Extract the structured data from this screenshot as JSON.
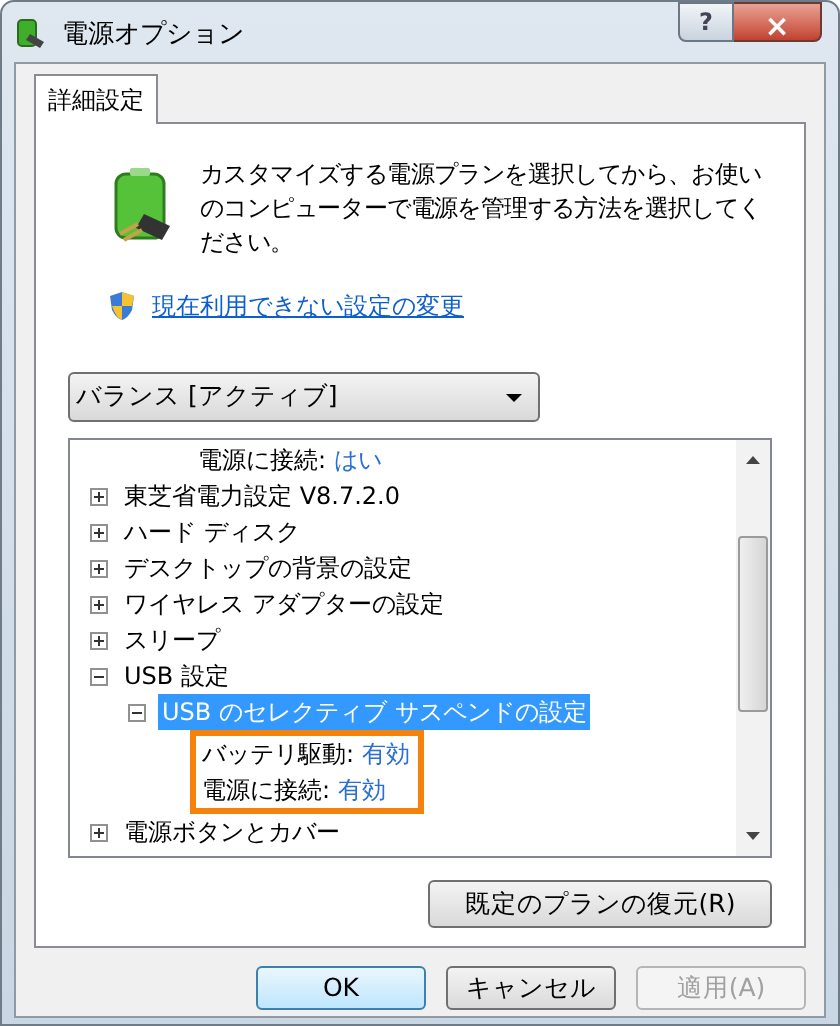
{
  "window": {
    "title": "電源オプション",
    "help": "?",
    "close": "×"
  },
  "tabs": [
    {
      "label": "詳細設定",
      "selected": true
    }
  ],
  "intro": "カスタマイズする電源プランを選択してから、お使いのコンピューターで電源を管理する方法を選択してください。",
  "admin_link": "現在利用できない設定の変更",
  "plan_select": {
    "value": "バランス [アクティブ]"
  },
  "tree": [
    {
      "kind": "setting",
      "label": "電源に接続:",
      "value": "はい"
    },
    {
      "kind": "group",
      "label": "東芝省電力設定 V8.7.2.0",
      "expanded": false,
      "selected": false
    },
    {
      "kind": "group",
      "label": "ハード ディスク",
      "expanded": false,
      "selected": false
    },
    {
      "kind": "group",
      "label": "デスクトップの背景の設定",
      "expanded": false,
      "selected": false
    },
    {
      "kind": "group",
      "label": "ワイヤレス アダプターの設定",
      "expanded": false,
      "selected": false
    },
    {
      "kind": "group",
      "label": "スリープ",
      "expanded": false,
      "selected": false
    },
    {
      "kind": "group",
      "label": "USB 設定",
      "expanded": true,
      "selected": false,
      "children": [
        {
          "kind": "group",
          "label": "USB のセレクティブ サスペンドの設定",
          "expanded": true,
          "selected": true,
          "outlined": true,
          "children": [
            {
              "kind": "setting",
              "label": "バッテリ駆動:",
              "value": "有効"
            },
            {
              "kind": "setting",
              "label": "電源に接続:",
              "value": "有効"
            }
          ]
        }
      ]
    },
    {
      "kind": "group",
      "label": "電源ボタンとカバー",
      "expanded": false,
      "selected": false
    }
  ],
  "restore_button": "既定のプランの復元(R)",
  "buttons": [
    {
      "label": "OK",
      "default": true,
      "disabled": false
    },
    {
      "label": "キャンセル",
      "default": false,
      "disabled": false
    },
    {
      "label": "適用(A)",
      "default": false,
      "disabled": true
    }
  ]
}
